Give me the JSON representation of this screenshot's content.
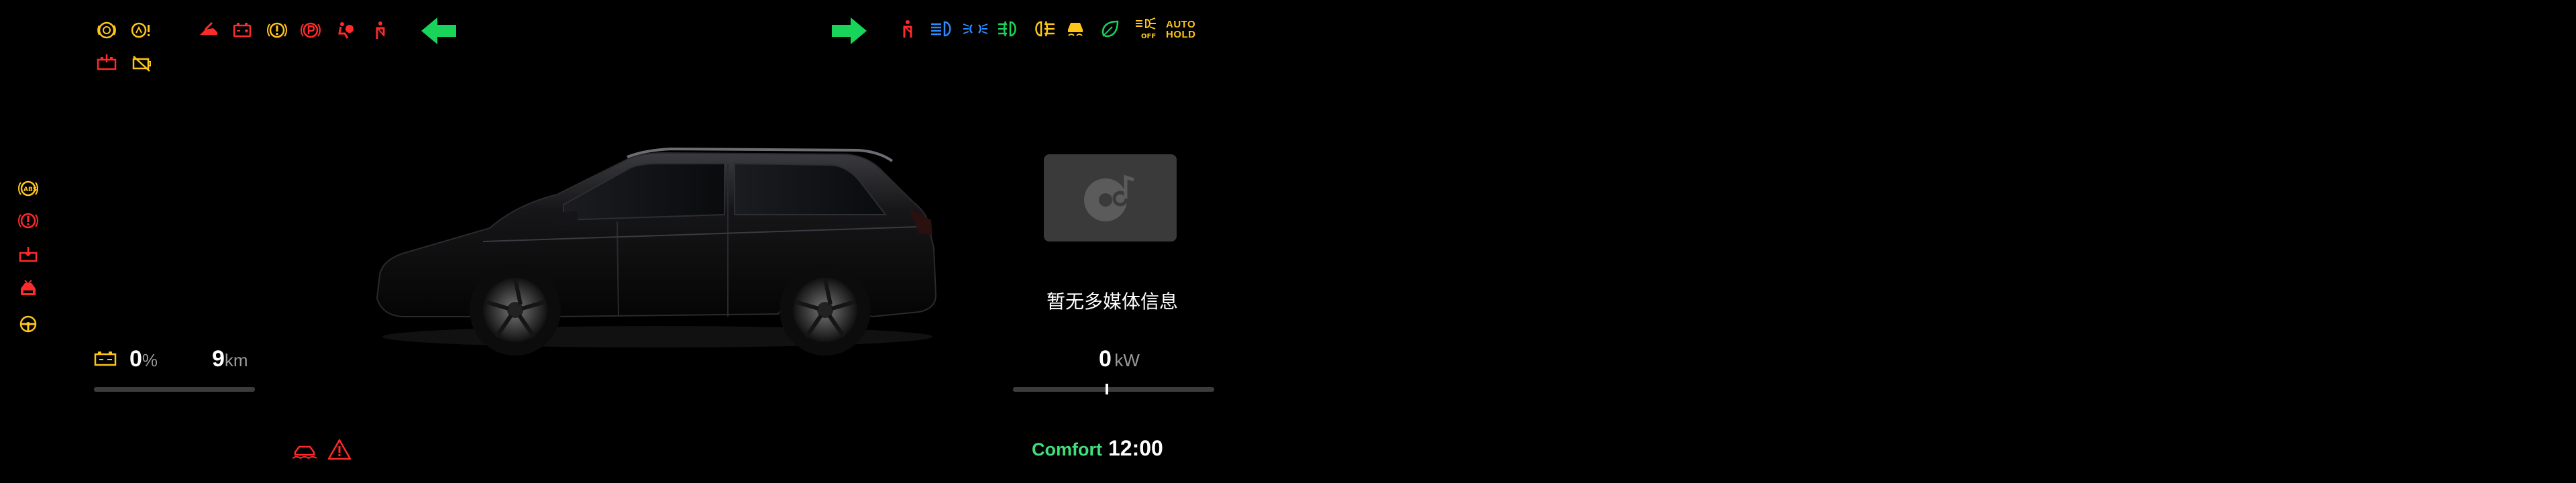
{
  "telltales": {
    "top_left_row1": [
      "service-icon",
      "tire-pressure-warning-icon",
      "hood-open-icon",
      "battery-warning-icon",
      "system-fault-icon",
      "parking-brake-icon",
      "airbag-icon",
      "seatbelt-icon"
    ],
    "top_left_row2": [
      "ev-battery-fault-icon",
      "charging-fault-icon"
    ],
    "turn_left": "left-turn-arrow-icon",
    "turn_right": "right-turn-arrow-icon",
    "top_right": [
      "seatbelt-rear-icon",
      "high-beam-icon",
      "position-lamps-icon",
      "front-fog-icon",
      "rear-fog-icon",
      "stability-control-icon",
      "ev-mode-icon",
      "auto-high-beam-off-icon"
    ],
    "auto_hold": {
      "line1": "AUTO",
      "line2": "HOLD"
    },
    "left_column": [
      "abs-icon",
      "brake-warning-icon",
      "charge-cable-icon",
      "power-limit-icon",
      "steering-fault-icon"
    ],
    "bottom_left": [
      "low-traction-icon",
      "general-warning-icon"
    ]
  },
  "battery": {
    "value": "0",
    "unit": "%"
  },
  "range": {
    "value": "9",
    "unit": "km"
  },
  "power": {
    "value": "0",
    "unit": "kW",
    "level": 0
  },
  "media": {
    "status_text": "暂无多媒体信息"
  },
  "footer": {
    "drive_mode": "Comfort",
    "time": "12:00"
  },
  "colors": {
    "amber": "#ffc61a",
    "red": "#ff2a2a",
    "green": "#19d45a",
    "blue": "#2a8cff",
    "mode_green": "#3fe07a"
  }
}
